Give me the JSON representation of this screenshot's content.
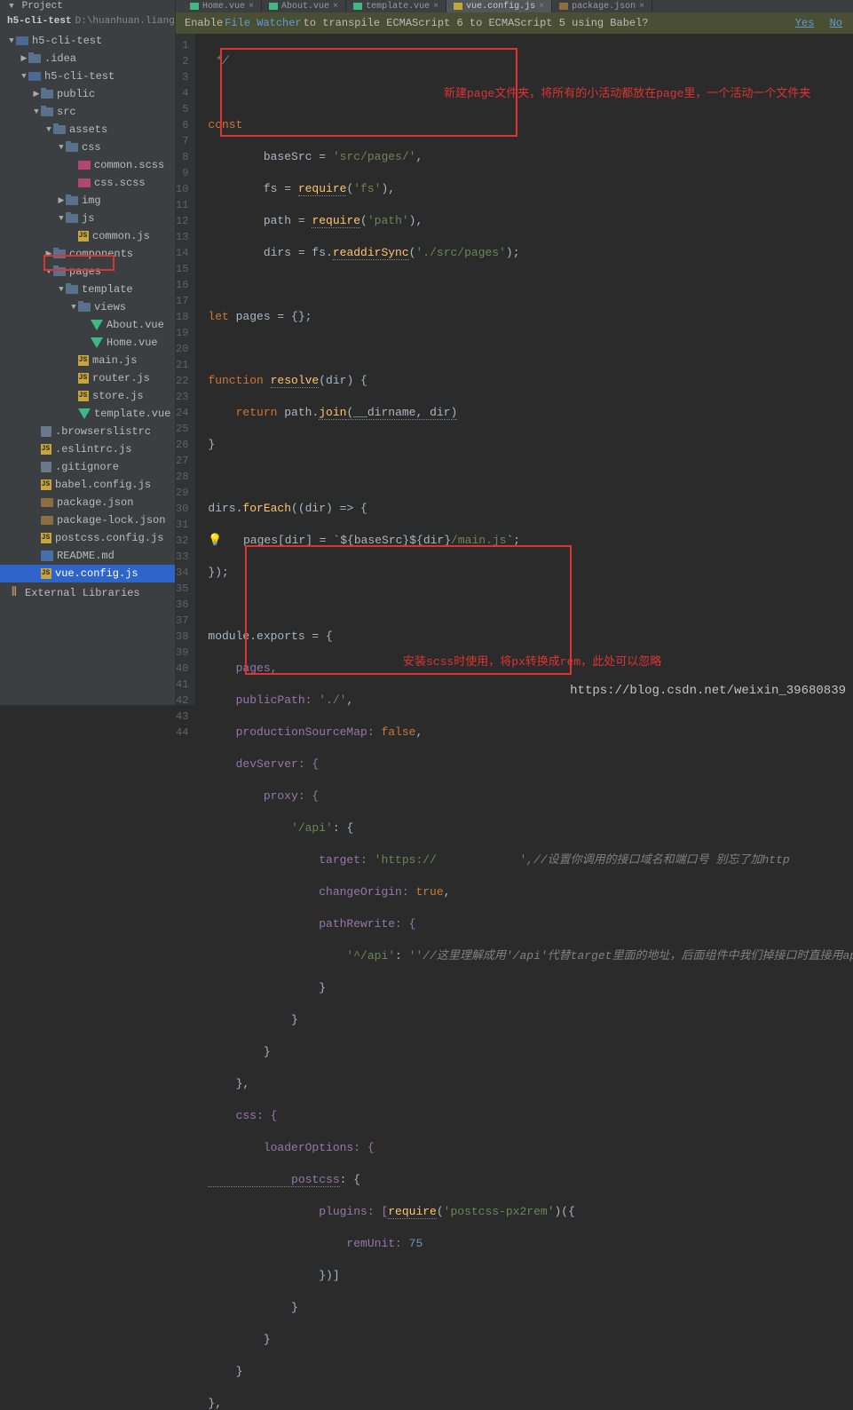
{
  "project_header": "Project",
  "path_root": "h5-cli-test",
  "path_rest": "D:\\huanhuan.liang\\vue",
  "infobar": {
    "pre": "Enable ",
    "link": "File Watcher",
    "post": " to transpile ECMAScript 6 to ECMAScript 5 using Babel?",
    "yes": "Yes",
    "no": "No"
  },
  "tabs": [
    {
      "label": "Home.vue"
    },
    {
      "label": "About.vue"
    },
    {
      "label": "template.vue"
    },
    {
      "label": "vue.config.js",
      "active": true
    },
    {
      "label": "package.json"
    }
  ],
  "tree": [
    {
      "d": 0,
      "a": "▼",
      "i": "module",
      "l": "h5-cli-test"
    },
    {
      "d": 1,
      "a": "▶",
      "i": "folder",
      "l": ".idea"
    },
    {
      "d": 1,
      "a": "▼",
      "i": "module",
      "l": "h5-cli-test"
    },
    {
      "d": 2,
      "a": "▶",
      "i": "folder",
      "l": "public"
    },
    {
      "d": 2,
      "a": "▼",
      "i": "folder",
      "l": "src"
    },
    {
      "d": 3,
      "a": "▼",
      "i": "folder",
      "l": "assets"
    },
    {
      "d": 4,
      "a": "▼",
      "i": "folder",
      "l": "css"
    },
    {
      "d": 5,
      "a": "",
      "i": "scss",
      "l": "common.scss"
    },
    {
      "d": 5,
      "a": "",
      "i": "scss",
      "l": "css.scss"
    },
    {
      "d": 4,
      "a": "▶",
      "i": "folder",
      "l": "img"
    },
    {
      "d": 4,
      "a": "▼",
      "i": "folder",
      "l": "js"
    },
    {
      "d": 5,
      "a": "",
      "i": "js",
      "l": "common.js"
    },
    {
      "d": 3,
      "a": "▶",
      "i": "folder",
      "l": "components"
    },
    {
      "d": 3,
      "a": "▼",
      "i": "folder",
      "l": "pages"
    },
    {
      "d": 4,
      "a": "▼",
      "i": "folder",
      "l": "template"
    },
    {
      "d": 5,
      "a": "▼",
      "i": "folder",
      "l": "views"
    },
    {
      "d": 6,
      "a": "",
      "i": "vue",
      "l": "About.vue"
    },
    {
      "d": 6,
      "a": "",
      "i": "vue",
      "l": "Home.vue"
    },
    {
      "d": 5,
      "a": "",
      "i": "js",
      "l": "main.js"
    },
    {
      "d": 5,
      "a": "",
      "i": "js",
      "l": "router.js"
    },
    {
      "d": 5,
      "a": "",
      "i": "js",
      "l": "store.js"
    },
    {
      "d": 5,
      "a": "",
      "i": "vue",
      "l": "template.vue"
    },
    {
      "d": 2,
      "a": "",
      "i": "txt",
      "l": ".browserslistrc"
    },
    {
      "d": 2,
      "a": "",
      "i": "js",
      "l": ".eslintrc.js"
    },
    {
      "d": 2,
      "a": "",
      "i": "txt",
      "l": ".gitignore"
    },
    {
      "d": 2,
      "a": "",
      "i": "js",
      "l": "babel.config.js"
    },
    {
      "d": 2,
      "a": "",
      "i": "json",
      "l": "package.json"
    },
    {
      "d": 2,
      "a": "",
      "i": "json",
      "l": "package-lock.json"
    },
    {
      "d": 2,
      "a": "",
      "i": "js",
      "l": "postcss.config.js"
    },
    {
      "d": 2,
      "a": "",
      "i": "md",
      "l": "README.md"
    },
    {
      "d": 2,
      "a": "",
      "i": "js",
      "l": "vue.config.js",
      "sel": true
    }
  ],
  "ext_lib": "External Libraries",
  "lines": [
    "1",
    "2",
    "3",
    "4",
    "5",
    "6",
    "7",
    "8",
    "9",
    "10",
    "11",
    "12",
    "13",
    "14",
    "15",
    "16",
    "17",
    "18",
    "19",
    "20",
    "21",
    "22",
    "23",
    "24",
    "25",
    "26",
    "27",
    "28",
    "29",
    "30",
    "31",
    "32",
    "33",
    "34",
    "35",
    "36",
    "37",
    "38",
    "39",
    "40",
    "41",
    "42",
    "43",
    "44"
  ],
  "code": {
    "l1": " */",
    "l3_const": "const",
    "l4_base": "        baseSrc = ",
    "l4_str": "'src/pages/'",
    "l4_end": ",",
    "l5_fs": "        fs = ",
    "l5_req": "require",
    "l5_str": "'fs'",
    "l5_end": "),",
    "l6_p": "        path = ",
    "l6_req": "require",
    "l6_str": "'path'",
    "l6_end": "),",
    "l7_d": "        dirs = fs.",
    "l7_fn": "readdirSync",
    "l7_str": "'./src/pages'",
    "l7_end": ");",
    "l9_let": "let",
    "l9_rest": " pages = {};",
    "l11_fn": "function ",
    "l11_name": "resolve",
    "l11_rest": "(dir) {",
    "l12_ret": "    return ",
    "l12_rest": "path.",
    "l12_join": "join",
    "l12_args": "(__dirname, dir)",
    "l13": "}",
    "l15_dirs": "dirs.",
    "l15_fe": "forEach",
    "l15_rest": "((dir) => {",
    "l16_bulb": "💡",
    "l16_rest": "   pages[dir] = `${baseSrc}${dir}",
    "l16_main": "/main.js",
    "l16_end": "`;",
    "l17": "});",
    "l19_mod": "module.exports = {",
    "l20": "    pages,",
    "l21_pp": "    publicPath: ",
    "l21_str": "'./'",
    "l21_end": ",",
    "l22_ps": "    productionSourceMap: ",
    "l22_bool": "false",
    "l22_end": ",",
    "l23": "    devServer: {",
    "l24": "        proxy: {",
    "l25_key": "            '/api'",
    "l25_rest": ": {",
    "l26_t": "                target: ",
    "l26_str": "'https://            '",
    "l26_cmt": ",//设置你调用的接口域名和端口号 别忘了加http",
    "l27_co": "                changeOrigin: ",
    "l27_bool": "true",
    "l27_end": ",",
    "l28": "                pathRewrite: {",
    "l29_key": "                    '^/api'",
    "l29_mid": ": ",
    "l29_str": "''",
    "l29_cmt": "//这里理解成用'/api'代替target里面的地址，后面组件中我们掉接口时直接用api代替",
    "l30": "                }",
    "l31": "            }",
    "l32": "        }",
    "l33": "    },",
    "l34": "    css: {",
    "l35": "        loaderOptions: {",
    "l36_pc": "            postcss",
    "l36_rest": ": {",
    "l37_pl": "                plugins: [",
    "l37_req": "require",
    "l37_str": "'postcss-px2rem'",
    "l37_end": ")({",
    "l38_ru": "                    remUnit: ",
    "l38_num": "75",
    "l39": "                })]",
    "l40": "            }",
    "l41": "        }",
    "l42": "    }",
    "l43": "},"
  },
  "anno1": "新建page文件夹，将所有的小活动都放在page里，一个活动一个文件夹",
  "anno2": "安装scss时使用，将px转换成rem，此处可以忽略",
  "watermark": "https://blog.csdn.net/weixin_39680839"
}
